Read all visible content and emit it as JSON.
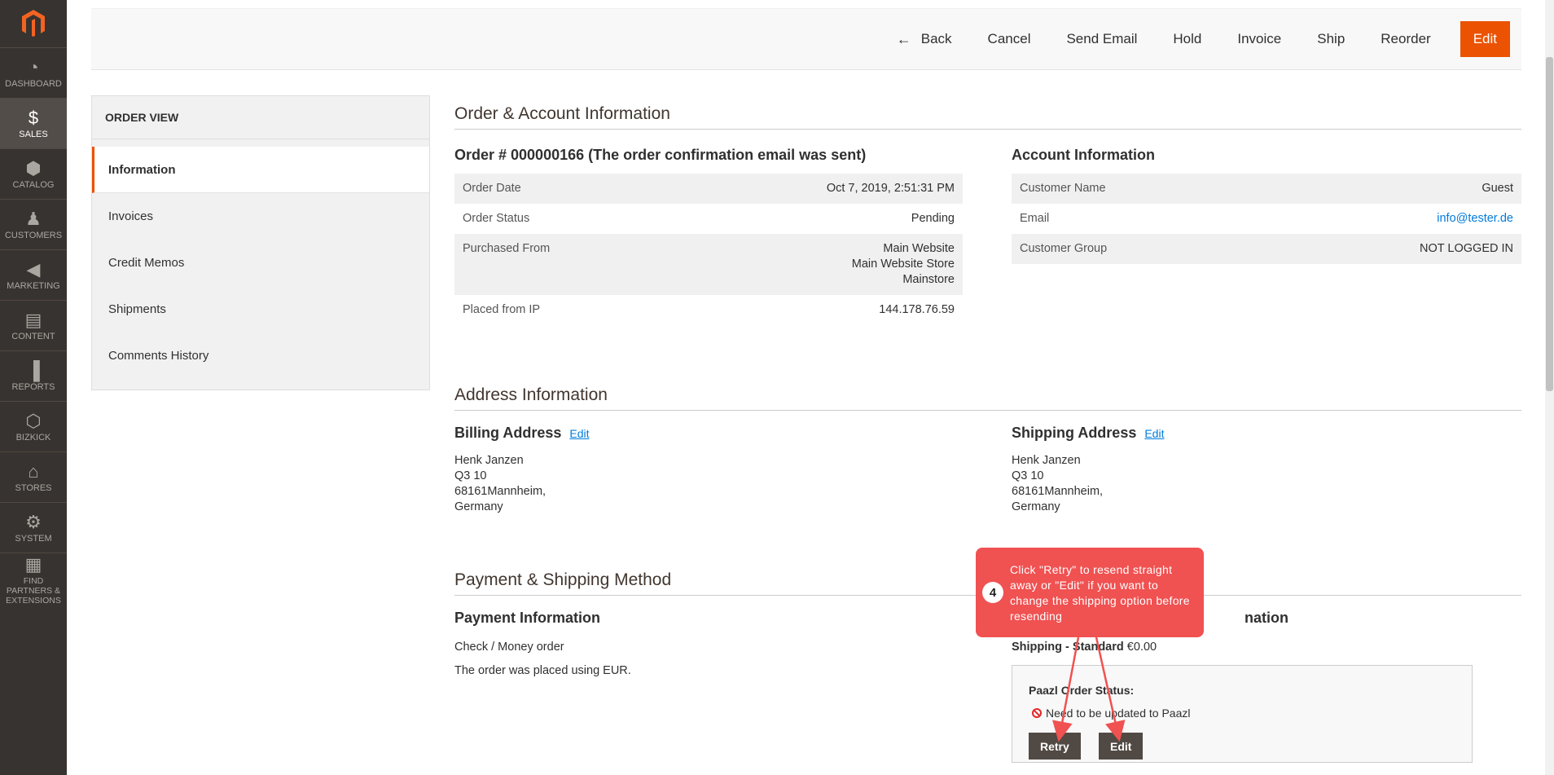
{
  "nav": {
    "items": [
      {
        "label": "DASHBOARD",
        "icon": "dashboard-icon"
      },
      {
        "label": "SALES",
        "icon": "dollar-icon"
      },
      {
        "label": "CATALOG",
        "icon": "cube-icon"
      },
      {
        "label": "CUSTOMERS",
        "icon": "person-icon"
      },
      {
        "label": "MARKETING",
        "icon": "megaphone-icon"
      },
      {
        "label": "CONTENT",
        "icon": "content-icon"
      },
      {
        "label": "REPORTS",
        "icon": "bar-chart-icon"
      },
      {
        "label": "BIZKICK",
        "icon": "hexagon-icon"
      },
      {
        "label": "STORES",
        "icon": "store-icon"
      },
      {
        "label": "SYSTEM",
        "icon": "gear-icon"
      },
      {
        "label": "FIND PARTNERS & EXTENSIONS",
        "icon": "boxes-icon"
      }
    ],
    "active": "SALES"
  },
  "toolbar": {
    "back": "Back",
    "cancel": "Cancel",
    "send_email": "Send Email",
    "hold": "Hold",
    "invoice": "Invoice",
    "ship": "Ship",
    "reorder": "Reorder",
    "edit": "Edit",
    "accent": "#eb5202"
  },
  "sidetabs": {
    "title": "ORDER VIEW",
    "tabs": [
      "Information",
      "Invoices",
      "Credit Memos",
      "Shipments",
      "Comments History"
    ]
  },
  "order_account": {
    "title": "Order & Account Information",
    "order_heading": "Order # 000000166 (The order confirmation email was sent)",
    "order_rows": [
      {
        "label": "Order Date",
        "value": "Oct 7, 2019, 2:51:31 PM"
      },
      {
        "label": "Order Status",
        "value": "Pending"
      },
      {
        "label": "Purchased From",
        "value_lines": [
          "Main Website",
          "Main Website Store",
          "Mainstore"
        ]
      },
      {
        "label": "Placed from IP",
        "value": "144.178.76.59"
      }
    ],
    "account_heading": "Account Information",
    "account_rows": [
      {
        "label": "Customer Name",
        "value": "Guest"
      },
      {
        "label": "Email",
        "value": "info@tester.de"
      },
      {
        "label": "Customer Group",
        "value": "NOT LOGGED IN"
      }
    ]
  },
  "address": {
    "title": "Address Information",
    "billing": {
      "heading": "Billing Address",
      "edit": "Edit",
      "lines": [
        "Henk Janzen",
        "Q3 10",
        "68161Mannheim,",
        "Germany"
      ]
    },
    "shipping": {
      "heading": "Shipping Address",
      "edit": "Edit",
      "lines": [
        "Henk Janzen",
        "Q3 10",
        "68161Mannheim,",
        "Germany"
      ]
    }
  },
  "payment_shipping": {
    "title": "Payment & Shipping Method",
    "payment_heading": "Payment Information",
    "payment_method": "Check / Money order",
    "currency_note": "The order was placed using EUR.",
    "shipping_heading_tail": "nation",
    "shipping_method_label": "Shipping - Standard",
    "shipping_price": "€0.00",
    "paazl_status_label": "Paazl Order Status:",
    "paazl_status_text": "Need to be updated to Paazl",
    "retry": "Retry",
    "edit": "Edit"
  },
  "callout": {
    "number": "4",
    "text": "Click \"Retry\" to resend straight away or \"Edit\" if you want to change the shipping option before resending",
    "color": "#f05151"
  }
}
